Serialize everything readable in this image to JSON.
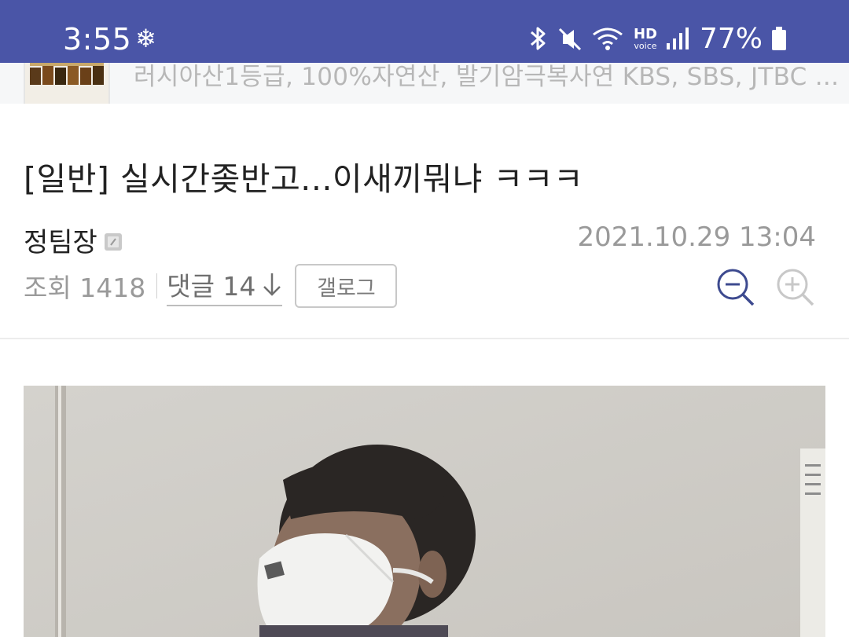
{
  "status_bar": {
    "time": "3:55",
    "battery": "77%",
    "network_label": "HD",
    "network_sublabel": "voice",
    "background": "#4a55a7"
  },
  "ad": {
    "text": "러시아산1등급, 100%자연산, 발기암극복사연 KBS, SBS, JTBC ..."
  },
  "post": {
    "title": "[일반] 실시간좆반고...이새끼뭐냐 ㅋㅋㅋ",
    "author": "정팀장",
    "date": "2021.10.29 13:04",
    "views": "조회 1418",
    "comments": "댓글 14",
    "gallog_label": "갤로그"
  },
  "colors": {
    "accent": "#3d4a8f",
    "muted": "#9a9a9a"
  },
  "icons": [
    "snowflake-icon",
    "bluetooth-icon",
    "mute-icon",
    "wifi-icon",
    "signal-icon",
    "battery-icon",
    "zoom-out-icon",
    "zoom-in-icon",
    "arrow-down-icon",
    "fixed-nick-icon"
  ]
}
